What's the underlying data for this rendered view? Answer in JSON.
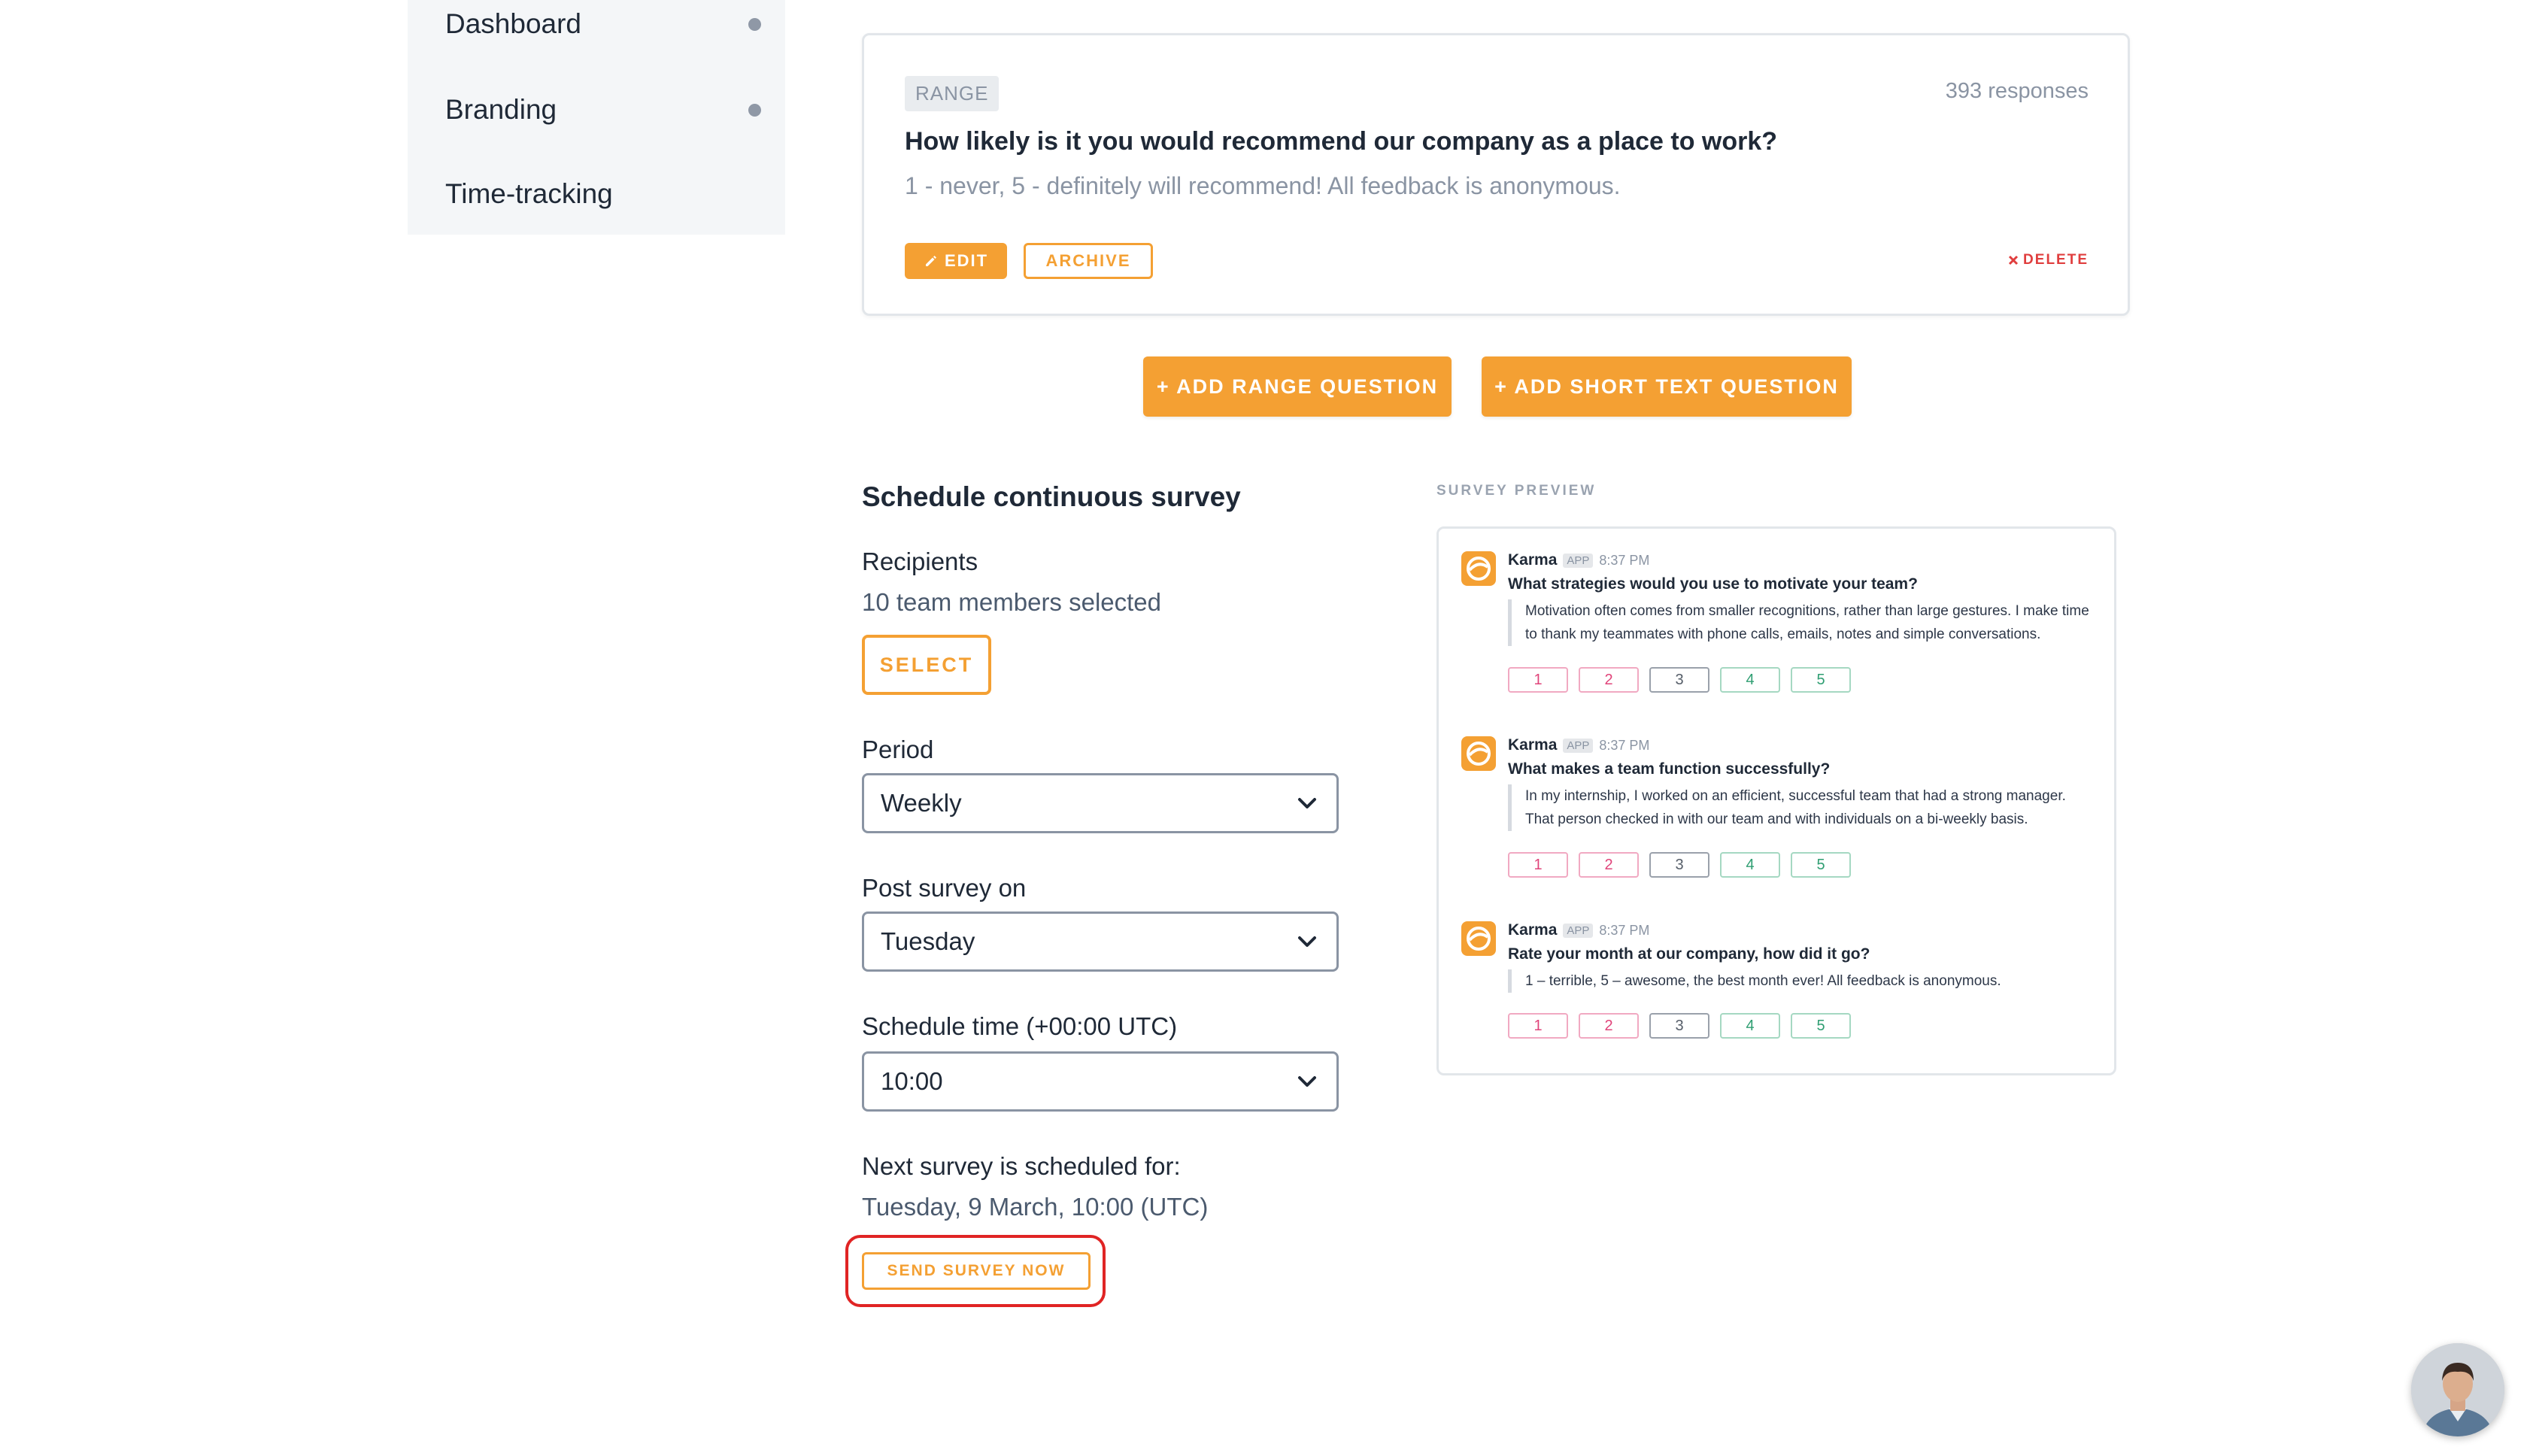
{
  "sidebar": {
    "items": [
      {
        "label": "Dashboard",
        "dot": true
      },
      {
        "label": "Branding",
        "dot": true
      },
      {
        "label": "Time-tracking",
        "dot": false
      }
    ]
  },
  "question_card": {
    "tag": "RANGE",
    "responses": "393 responses",
    "title": "How likely is it you would recommend our company as a place to work?",
    "description": "1 - never, 5 - definitely will recommend! All feedback is anonymous.",
    "edit_label": "EDIT",
    "archive_label": "ARCHIVE",
    "delete_label": "DELETE"
  },
  "add_buttons": {
    "range": "+ ADD RANGE QUESTION",
    "short_text": "+ ADD SHORT TEXT QUESTION"
  },
  "schedule": {
    "title": "Schedule continuous survey",
    "recipients_label": "Recipients",
    "recipients_value": "10 team members selected",
    "select_label": "SELECT",
    "period_label": "Period",
    "period_value": "Weekly",
    "post_label": "Post survey on",
    "post_value": "Tuesday",
    "time_label": "Schedule time (+00:00 UTC)",
    "time_value": "10:00",
    "next_label": "Next survey is scheduled for:",
    "next_value": "Tuesday, 9 March, 10:00 (UTC)",
    "send_now_label": "SEND SURVEY NOW"
  },
  "preview": {
    "label": "SURVEY PREVIEW",
    "messages": [
      {
        "name": "Karma",
        "app": "APP",
        "time": "8:37 PM",
        "question": "What strategies would you use to motivate your team?",
        "quote": "Motivation often comes from smaller recognitions, rather than large gestures. I make time to thank my teammates with phone calls, emails, notes and simple conversations.",
        "options": [
          "1",
          "2",
          "3",
          "4",
          "5"
        ]
      },
      {
        "name": "Karma",
        "app": "APP",
        "time": "8:37 PM",
        "question": "What makes a team function successfully?",
        "quote": "In my internship, I worked on an efficient, successful team that had a strong manager. That person checked in with our team and with individuals on a bi-weekly basis.",
        "options": [
          "1",
          "2",
          "3",
          "4",
          "5"
        ]
      },
      {
        "name": "Karma",
        "app": "APP",
        "time": "8:37 PM",
        "question": "Rate your month at our company, how did it go?",
        "quote": "1 – terrible, 5 – awesome, the best month ever! All feedback is anonymous.",
        "options": [
          "1",
          "2",
          "3",
          "4",
          "5"
        ]
      }
    ],
    "option_colors": [
      "#e0447a",
      "#e0447a",
      "#555d68",
      "#2f9e72",
      "#2f9e72"
    ]
  },
  "colors": {
    "accent": "#f4a033",
    "highlight": "#e02424",
    "delete": "#e03e3e"
  }
}
